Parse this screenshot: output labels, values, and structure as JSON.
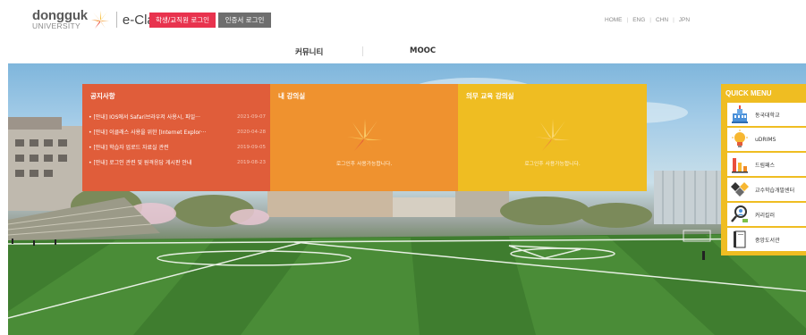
{
  "header": {
    "logo_main": "dongguk",
    "logo_sub": "UNIVERSITY",
    "logo_product": "e-Class",
    "student_login": "학생/교직원 로그인",
    "cert_login": "인증서 로그인",
    "lang_items": [
      "HOME",
      "ENG",
      "CHN",
      "JPN"
    ]
  },
  "nav": {
    "items": [
      "커뮤니티",
      "MOOC"
    ]
  },
  "notice": {
    "title": "공지사항",
    "rows": [
      {
        "text": "• [안내] IOS에서 Safari브라우저 사용시, 파일···",
        "date": "2021-09-07"
      },
      {
        "text": "• [안내] 이클래스 사용을 위한 [Internet Explor···",
        "date": "2020-04-28"
      },
      {
        "text": "• [안내] 학습자 업로드 자료실 관련",
        "date": "2019-09-05"
      },
      {
        "text": "• [안내] 로그인 관련 및 원격응답 게시판 안내",
        "date": "2019-08-23"
      }
    ]
  },
  "my_class": {
    "title": "내 강의실",
    "empty_msg": "로그인후 사용가능합니다."
  },
  "compulsory": {
    "title": "의무 교육 강의실",
    "empty_msg": "로그인후 사용가능합니다."
  },
  "quick_menu": {
    "title": "QUICK MENU",
    "items": [
      {
        "label": "동국대학교",
        "icon": "university-building-icon"
      },
      {
        "label": "uDRIMS",
        "icon": "lightbulb-icon"
      },
      {
        "label": "드림패스",
        "icon": "bar-chart-icon"
      },
      {
        "label": "교수학습개발센터",
        "icon": "diamond-shapes-icon"
      },
      {
        "label": "커리킬러",
        "icon": "magnifier-person-icon"
      },
      {
        "label": "중앙도서관",
        "icon": "book-icon"
      }
    ]
  },
  "colors": {
    "login_accent": "#e8334e",
    "cert_gray": "#6e6e6e",
    "notice_panel": "#e05d3a",
    "my_class_panel": "#ef922f",
    "compulsory_panel": "#efbd22",
    "quick_menu": "#efbd22"
  }
}
